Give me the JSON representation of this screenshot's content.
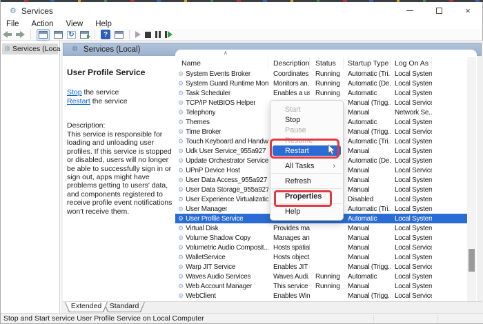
{
  "titlebar": {
    "title": "Services",
    "close_glyph": "×"
  },
  "menubar": {
    "items": [
      "File",
      "Action",
      "View",
      "Help"
    ]
  },
  "icons": {
    "gear_glyph": "⚙",
    "refresh_glyph": "↻",
    "help_glyph": "?",
    "submenu_arrow": "›",
    "sort_ascending": "∧"
  },
  "sidebar": {
    "root_label": "Services (Local)"
  },
  "header_bar": {
    "label": "Services (Local)"
  },
  "extended_panel": {
    "service_name": "User Profile Service",
    "stop_link": "Stop",
    "stop_rest": " the service",
    "restart_link": "Restart",
    "restart_rest": " the service",
    "description_label": "Description:",
    "description": "This service is responsible for loading and unloading user profiles. If this service is stopped or disabled, users will no longer be able to successfully sign in or sign out, apps might have problems getting to users' data, and components registered to receive profile event notifications won't receive them."
  },
  "table": {
    "columns": [
      "Name",
      "Description",
      "Status",
      "Startup Type",
      "Log On As"
    ],
    "rows": [
      {
        "name": "System Events Broker",
        "description": "Coordinates ...",
        "status": "Running",
        "startup": "Automatic (Tri...",
        "logon": "Local System",
        "selected": false
      },
      {
        "name": "System Guard Runtime Mon...",
        "description": "Monitors an...",
        "status": "Running",
        "startup": "Automatic (De...",
        "logon": "Local System",
        "selected": false
      },
      {
        "name": "Task Scheduler",
        "description": "Enables a us...",
        "status": "Running",
        "startup": "Automatic",
        "logon": "Local System",
        "selected": false
      },
      {
        "name": "TCP/IP NetBIOS Helper",
        "description": "",
        "status": "",
        "startup": "Manual (Trigg...",
        "logon": "Local Service",
        "selected": false
      },
      {
        "name": "Telephony",
        "description": "",
        "status": "",
        "startup": "Manual",
        "logon": "Network Se...",
        "selected": false
      },
      {
        "name": "Themes",
        "description": "",
        "status": "",
        "startup": "Automatic",
        "logon": "Local System",
        "selected": false
      },
      {
        "name": "Time Broker",
        "description": "",
        "status": "",
        "startup": "Manual (Trigg...",
        "logon": "Local Service",
        "selected": false
      },
      {
        "name": "Touch Keyboard and Handw...",
        "description": "",
        "status": "",
        "startup": "Automatic (Tri...",
        "logon": "Local System",
        "selected": false
      },
      {
        "name": "Udk User Service_955a927",
        "description": "",
        "status": "",
        "startup": "Manual",
        "logon": "Local System",
        "selected": false
      },
      {
        "name": "Update Orchestrator Service",
        "description": "",
        "status": "",
        "startup": "Automatic (De...",
        "logon": "Local System",
        "selected": false
      },
      {
        "name": "UPnP Device Host",
        "description": "",
        "status": "",
        "startup": "Manual",
        "logon": "Local Service",
        "selected": false
      },
      {
        "name": "User Data Access_955a927",
        "description": "",
        "status": "",
        "startup": "Manual",
        "logon": "Local System",
        "selected": false
      },
      {
        "name": "User Data Storage_955a927",
        "description": "",
        "status": "",
        "startup": "Manual",
        "logon": "Local System",
        "selected": false
      },
      {
        "name": "User Experience Virtualizatio...",
        "description": "",
        "status": "",
        "startup": "Disabled",
        "logon": "Local System",
        "selected": false
      },
      {
        "name": "User Manager",
        "description": "",
        "status": "",
        "startup": "Automatic (Tri...",
        "logon": "Local System",
        "selected": false
      },
      {
        "name": "User Profile Service",
        "description": "",
        "status": "",
        "startup": "Automatic",
        "logon": "Local System",
        "selected": true
      },
      {
        "name": "Virtual Disk",
        "description": "Provides ma...",
        "status": "",
        "startup": "Manual",
        "logon": "Local System",
        "selected": false
      },
      {
        "name": "Volume Shadow Copy",
        "description": "Manages an...",
        "status": "",
        "startup": "Manual",
        "logon": "Local System",
        "selected": false
      },
      {
        "name": "Volumetric Audio Composit...",
        "description": "Hosts spatial...",
        "status": "",
        "startup": "Manual",
        "logon": "Local Service",
        "selected": false
      },
      {
        "name": "WalletService",
        "description": "Hosts object...",
        "status": "",
        "startup": "Manual",
        "logon": "Local System",
        "selected": false
      },
      {
        "name": "Warp JIT Service",
        "description": "Enables JIT c...",
        "status": "",
        "startup": "Manual (Trigg...",
        "logon": "Local Service",
        "selected": false
      },
      {
        "name": "Waves Audio Services",
        "description": "Waves Audi...",
        "status": "Running",
        "startup": "Automatic",
        "logon": "Local System",
        "selected": false
      },
      {
        "name": "Web Account Manager",
        "description": "This service i...",
        "status": "Running",
        "startup": "Manual",
        "logon": "Local System",
        "selected": false
      },
      {
        "name": "WebClient",
        "description": "Enables Win...",
        "status": "",
        "startup": "Manual (Trigg...",
        "logon": "Local Service",
        "selected": false
      }
    ]
  },
  "context_menu": {
    "items": [
      {
        "label": "Start",
        "disabled": true,
        "highlighted": false,
        "bold": false,
        "submenu": false,
        "sep_after": false
      },
      {
        "label": "Stop",
        "disabled": false,
        "highlighted": false,
        "bold": false,
        "submenu": false,
        "sep_after": false
      },
      {
        "label": "Pause",
        "disabled": true,
        "highlighted": false,
        "bold": false,
        "submenu": false,
        "sep_after": false
      },
      {
        "label": "Resume",
        "disabled": true,
        "highlighted": false,
        "bold": false,
        "submenu": false,
        "sep_after": false
      },
      {
        "label": "Restart",
        "disabled": false,
        "highlighted": true,
        "bold": false,
        "submenu": false,
        "sep_after": true
      },
      {
        "label": "All Tasks",
        "disabled": false,
        "highlighted": false,
        "bold": false,
        "submenu": true,
        "sep_after": true
      },
      {
        "label": "Refresh",
        "disabled": false,
        "highlighted": false,
        "bold": false,
        "submenu": false,
        "sep_after": true
      },
      {
        "label": "Properties",
        "disabled": false,
        "highlighted": false,
        "bold": true,
        "submenu": false,
        "sep_after": true
      },
      {
        "label": "Help",
        "disabled": false,
        "highlighted": false,
        "bold": false,
        "submenu": false,
        "sep_after": false
      }
    ]
  },
  "tabs": {
    "extended": "Extended",
    "standard": "Standard"
  },
  "statusbar": {
    "text": "Stop and Start service User Profile Service on Local Computer"
  },
  "colors": {
    "selection": "#2a6cd3",
    "annotation": "#e2383f",
    "header_bar": "#a7bbd4",
    "link": "#0b62c4"
  }
}
